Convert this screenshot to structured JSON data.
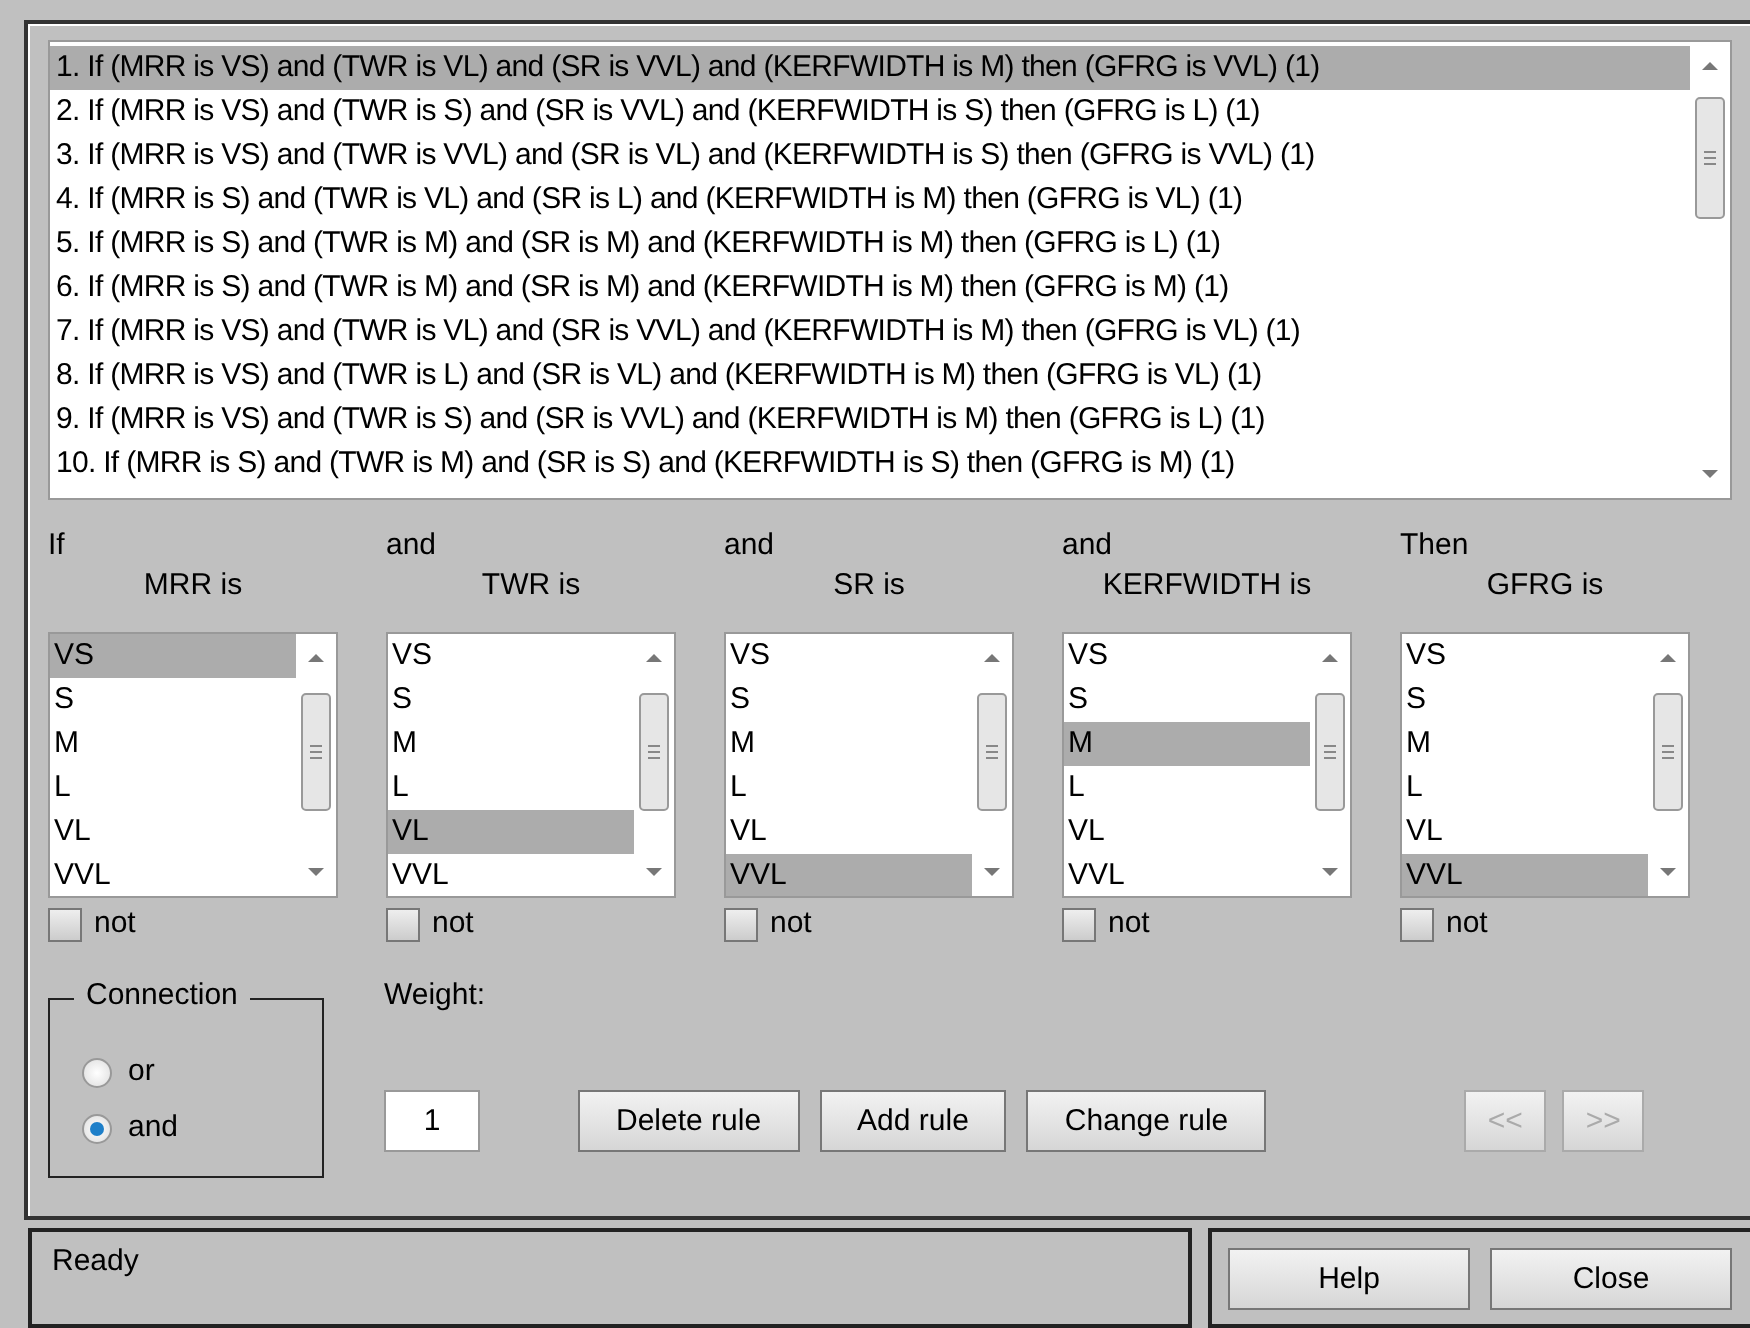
{
  "rules": [
    {
      "text": "1. If (MRR is VS) and (TWR is VL) and (SR is VVL) and (KERFWIDTH is M) then (GFRG is VVL) (1)",
      "selected": true
    },
    {
      "text": "2. If (MRR is VS) and (TWR is S) and (SR is VVL) and (KERFWIDTH is S) then (GFRG is L) (1)",
      "selected": false
    },
    {
      "text": "3. If (MRR is VS) and (TWR is VVL) and (SR is VL) and (KERFWIDTH is S) then (GFRG is VVL) (1)",
      "selected": false
    },
    {
      "text": "4. If (MRR is S) and (TWR is VL) and (SR is L) and (KERFWIDTH is M) then (GFRG is VL) (1)",
      "selected": false
    },
    {
      "text": "5. If (MRR is S) and (TWR is M) and (SR is M) and (KERFWIDTH is M) then (GFRG is L) (1)",
      "selected": false
    },
    {
      "text": "6. If (MRR is S) and (TWR is M) and (SR is M) and (KERFWIDTH is M) then (GFRG is M) (1)",
      "selected": false
    },
    {
      "text": "7. If (MRR is VS) and (TWR is VL) and (SR is VVL) and (KERFWIDTH is M) then (GFRG is VL) (1)",
      "selected": false
    },
    {
      "text": "8. If (MRR is VS) and (TWR is L) and (SR is VL) and (KERFWIDTH is M) then (GFRG is VL) (1)",
      "selected": false
    },
    {
      "text": "9. If (MRR is VS) and (TWR is S) and (SR is VVL) and (KERFWIDTH is M) then (GFRG is L) (1)",
      "selected": false
    },
    {
      "text": "10. If (MRR is S) and (TWR is M) and (SR is S) and (KERFWIDTH is S) then (GFRG is M) (1)",
      "selected": false
    }
  ],
  "variables": [
    {
      "connector": "If",
      "label": "MRR is",
      "not_label": "not",
      "not": false,
      "options": [
        {
          "label": "VS",
          "selected": true
        },
        {
          "label": "S",
          "selected": false
        },
        {
          "label": "M",
          "selected": false
        },
        {
          "label": "L",
          "selected": false
        },
        {
          "label": "VL",
          "selected": false
        },
        {
          "label": "VVL",
          "selected": false
        }
      ]
    },
    {
      "connector": "and",
      "label": "TWR is",
      "not_label": "not",
      "not": false,
      "options": [
        {
          "label": "VS",
          "selected": false
        },
        {
          "label": "S",
          "selected": false
        },
        {
          "label": "M",
          "selected": false
        },
        {
          "label": "L",
          "selected": false
        },
        {
          "label": "VL",
          "selected": true
        },
        {
          "label": "VVL",
          "selected": false
        }
      ]
    },
    {
      "connector": "and",
      "label": "SR is",
      "not_label": "not",
      "not": false,
      "options": [
        {
          "label": "VS",
          "selected": false
        },
        {
          "label": "S",
          "selected": false
        },
        {
          "label": "M",
          "selected": false
        },
        {
          "label": "L",
          "selected": false
        },
        {
          "label": "VL",
          "selected": false
        },
        {
          "label": "VVL",
          "selected": true
        }
      ]
    },
    {
      "connector": "and",
      "label": "KERFWIDTH is",
      "not_label": "not",
      "not": false,
      "options": [
        {
          "label": "VS",
          "selected": false
        },
        {
          "label": "S",
          "selected": false
        },
        {
          "label": "M",
          "selected": true
        },
        {
          "label": "L",
          "selected": false
        },
        {
          "label": "VL",
          "selected": false
        },
        {
          "label": "VVL",
          "selected": false
        }
      ]
    },
    {
      "connector": "Then",
      "label": "GFRG is",
      "not_label": "not",
      "not": false,
      "options": [
        {
          "label": "VS",
          "selected": false
        },
        {
          "label": "S",
          "selected": false
        },
        {
          "label": "M",
          "selected": false
        },
        {
          "label": "L",
          "selected": false
        },
        {
          "label": "VL",
          "selected": false
        },
        {
          "label": "VVL",
          "selected": true
        }
      ]
    }
  ],
  "connection": {
    "title": "Connection",
    "options": [
      {
        "label": "or",
        "selected": false
      },
      {
        "label": "and",
        "selected": true
      }
    ]
  },
  "weight": {
    "label": "Weight:",
    "value": "1"
  },
  "rule_buttons": [
    {
      "label": "Delete rule",
      "disabled": false
    },
    {
      "label": "Add rule",
      "disabled": false
    },
    {
      "label": "Change rule",
      "disabled": false
    }
  ],
  "nav_buttons": [
    {
      "label": "<<",
      "disabled": true
    },
    {
      "label": ">>",
      "disabled": true
    }
  ],
  "status": "Ready",
  "footer_buttons": [
    {
      "label": "Help"
    },
    {
      "label": "Close"
    }
  ]
}
